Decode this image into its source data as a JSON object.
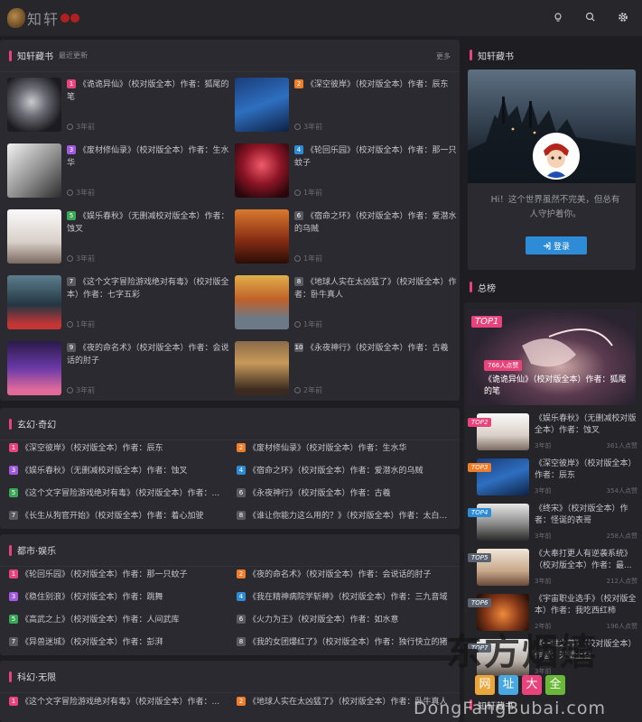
{
  "header": {
    "logo_text": "知轩",
    "icons": [
      "lamp-icon",
      "search-icon",
      "settings-icon"
    ]
  },
  "featured": {
    "title": "知轩藏书",
    "subtitle": "最近更新",
    "more": "更多",
    "books": [
      {
        "rank": "1",
        "title": "《诡诡异仙》（校对版全本）作者：狐尾的笔",
        "time": "3年前"
      },
      {
        "rank": "2",
        "title": "《深空彼岸》（校对版全本）作者：辰东",
        "time": "3年前"
      },
      {
        "rank": "3",
        "title": "《废材修仙录》（校对版全本）作者：生水华",
        "time": "3年前"
      },
      {
        "rank": "4",
        "title": "《轮回乐园》（校对版全本）作者：那一只蚊子",
        "time": "1年前"
      },
      {
        "rank": "5",
        "title": "《娱乐春秋》（无删减校对版全本）作者：蚀叉",
        "time": "3年前"
      },
      {
        "rank": "6",
        "title": "《宿命之环》（校对版全本）作者：爱潜水的乌贼",
        "time": "1年前"
      },
      {
        "rank": "7",
        "title": "《这个文字冒险游戏绝对有毒》（校对版全本）作者：七字五彩",
        "time": "1年前"
      },
      {
        "rank": "8",
        "title": "《地球人实在太凶猛了》（校对版全本）作者：卧牛真人",
        "time": "1年前"
      },
      {
        "rank": "9",
        "title": "《夜的命名术》（校对版全本）作者：会说话的肘子",
        "time": "3年前"
      },
      {
        "rank": "10",
        "title": "《永夜神行》（校对版全本）作者：古羲",
        "time": "2年前"
      }
    ]
  },
  "lists": [
    {
      "title": "玄幻·奇幻",
      "items": [
        {
          "rank": "1",
          "text": "《深空彼岸》（校对版全本）作者：辰东"
        },
        {
          "rank": "2",
          "text": "《废材修仙录》（校对版全本）作者：生水华"
        },
        {
          "rank": "3",
          "text": "《娱乐春秋》（无删减校对版全本）作者：蚀叉"
        },
        {
          "rank": "4",
          "text": "《宿命之环》（校对版全本）作者：爱潜水的乌贼"
        },
        {
          "rank": "5",
          "text": "《这个文字冒险游戏绝对有毒》（校对版全本）作者：..."
        },
        {
          "rank": "6",
          "text": "《永夜神行》（校对版全本）作者：古羲"
        },
        {
          "rank": "7",
          "text": "《长生从狗官开始》（校对版全本）作者：着心加驶"
        },
        {
          "rank": "8",
          "text": "《谁让你能力这么用的？》（校对版全本）作者：太白..."
        }
      ]
    },
    {
      "title": "都市·娱乐",
      "items": [
        {
          "rank": "1",
          "text": "《轮回乐园》（校对版全本）作者：那一只蚊子"
        },
        {
          "rank": "2",
          "text": "《夜的命名术》（校对版全本）作者：会说话的肘子"
        },
        {
          "rank": "3",
          "text": "《稳住别浪》（校对版全本）作者：跳舞"
        },
        {
          "rank": "4",
          "text": "《我在精神病院学斩神》（校对版全本）作者：三九音域"
        },
        {
          "rank": "5",
          "text": "《高武之上》（校对版全本）作者：人间武库"
        },
        {
          "rank": "6",
          "text": "《火力为王》（校对版全本）作者：如水意"
        },
        {
          "rank": "7",
          "text": "《异兽迷城》（校对版全本）作者：彭湃"
        },
        {
          "rank": "8",
          "text": "《我的女团爆红了》（校对版全本）作者：独行快立的猪"
        }
      ]
    },
    {
      "title": "科幻·无限",
      "items": [
        {
          "rank": "1",
          "text": "《这个文字冒险游戏绝对有毒》（校对版全本）作者：..."
        },
        {
          "rank": "2",
          "text": "《地球人实在太凶猛了》（校对版全本）作者：卧牛真人"
        }
      ]
    }
  ],
  "sidebar": {
    "profile_title": "知轩藏书",
    "welcome": "Hi！这个世界虽然不完美，但总有人守护着你。",
    "login": "登录",
    "hot_title": "总榜",
    "top1": {
      "badge": "TOP1",
      "views": "766人点赞",
      "title": "《诡诡异仙》（校对版全本）作者：狐尾的笔"
    },
    "hot": [
      {
        "badge": "TOP2",
        "title": "《娱乐春秋》（无删减校对版全本）作者：蚀叉",
        "time": "3年前",
        "views": "361人点赞"
      },
      {
        "badge": "TOP3",
        "title": "《深空彼岸》（校对版全本）作者：辰东",
        "time": "3年前",
        "views": "354人点赞"
      },
      {
        "badge": "TOP4",
        "title": "《终宋》（校对版全本）作者：怪诞的表哥",
        "time": "3年前",
        "views": "258人点赞"
      },
      {
        "badge": "TOP5",
        "title": "《大奉打更人有逆袭系统》（校对版全本）作者：最...",
        "time": "3年前",
        "views": "212人点赞"
      },
      {
        "badge": "TOP6",
        "title": "《宇宙职业选手》（校对版全本）作者：我吃西红柿",
        "time": "2年前",
        "views": "196人点赞"
      },
      {
        "badge": "TOP7",
        "title": "《一世之尊》（校对版全本）作者：天蚕土豆",
        "time": "3年前",
        "views": ""
      }
    ],
    "next_section": "知轩藏书"
  },
  "watermark": {
    "big": "东方烟嬉",
    "tags": [
      "网",
      "址",
      "大",
      "全"
    ],
    "url": "DongFangBubai.com"
  },
  "colors": {
    "accent": "#e8437a",
    "login": "#2e8bd6",
    "bg": "#1e1e22",
    "panel": "#2a2a30"
  }
}
